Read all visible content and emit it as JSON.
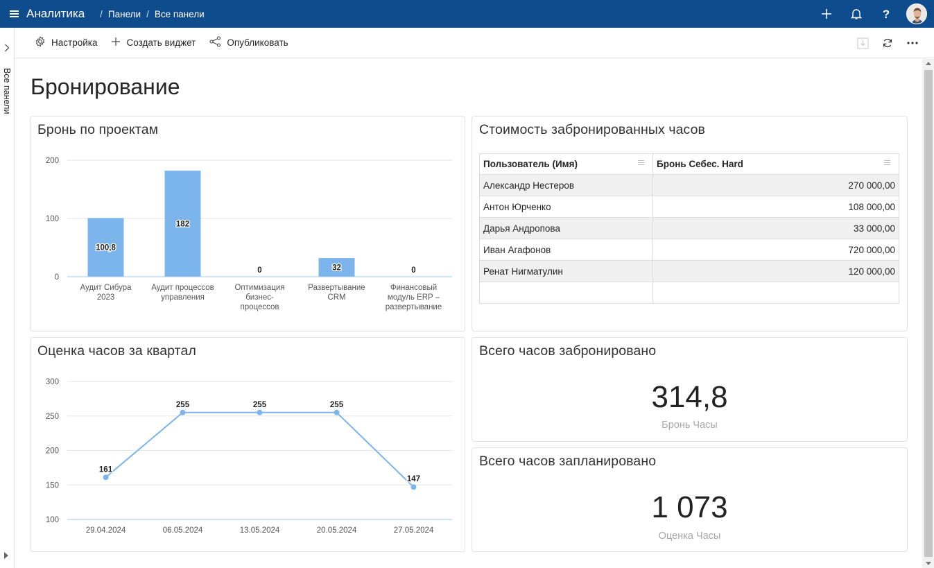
{
  "header": {
    "app_title": "Аналитика",
    "breadcrumb": [
      {
        "label": "Панели"
      },
      {
        "label": "Все панели"
      }
    ]
  },
  "rail": {
    "label": "Все панели"
  },
  "commands": {
    "settings": "Настройка",
    "create_widget": "Создать виджет",
    "publish": "Опубликовать"
  },
  "page": {
    "title": "Бронирование"
  },
  "widgets": {
    "bookings_by_project": {
      "title": "Бронь по проектам"
    },
    "booked_cost": {
      "title": "Стоимость забронированных часов",
      "columns": [
        "Пользователь (Имя)",
        "Бронь Себес. Hard"
      ],
      "rows": [
        [
          "Александр Нестеров",
          "270 000,00"
        ],
        [
          "Антон Юрченко",
          "108 000,00"
        ],
        [
          "Дарья Андропова",
          "33 000,00"
        ],
        [
          "Иван Агафонов",
          "720 000,00"
        ],
        [
          "Ренат Нигматулин",
          "120 000,00"
        ]
      ]
    },
    "quarter_estimate": {
      "title": "Оценка часов за квартал"
    },
    "total_booked": {
      "title": "Всего часов забронировано",
      "value": "314,8",
      "label": "Бронь Часы"
    },
    "total_planned": {
      "title": "Всего часов запланировано",
      "value": "1 073",
      "label": "Оценка Часы"
    }
  },
  "colors": {
    "topbar": "#0f4c8e",
    "series": "#7cb5ec"
  },
  "chart_data": [
    {
      "type": "bar",
      "title": "Бронь по проектам",
      "categories": [
        [
          "Аудит Сибура",
          "2023"
        ],
        [
          "Аудит процессов",
          "управления"
        ],
        [
          "Оптимизация",
          "бизнес-",
          "процессов"
        ],
        [
          "Развертывание",
          "CRM"
        ],
        [
          "Финансовый",
          "модуль ERP –",
          "развертывание"
        ]
      ],
      "values": [
        100.8,
        182,
        0,
        32,
        0
      ],
      "value_labels": [
        "100,8",
        "182",
        "0",
        "32",
        "0"
      ],
      "ylim": [
        0,
        200
      ],
      "yticks": [
        0,
        100,
        200
      ],
      "grid": true
    },
    {
      "type": "line",
      "title": "Оценка часов за квартал",
      "x": [
        "29.04.2024",
        "06.05.2024",
        "13.05.2024",
        "20.05.2024",
        "27.05.2024"
      ],
      "values": [
        161,
        255,
        255,
        255,
        147
      ],
      "value_labels": [
        "161",
        "255",
        "255",
        "255",
        "147"
      ],
      "ylim": [
        100,
        300
      ],
      "yticks": [
        100,
        150,
        200,
        250,
        300
      ],
      "grid": true
    }
  ]
}
